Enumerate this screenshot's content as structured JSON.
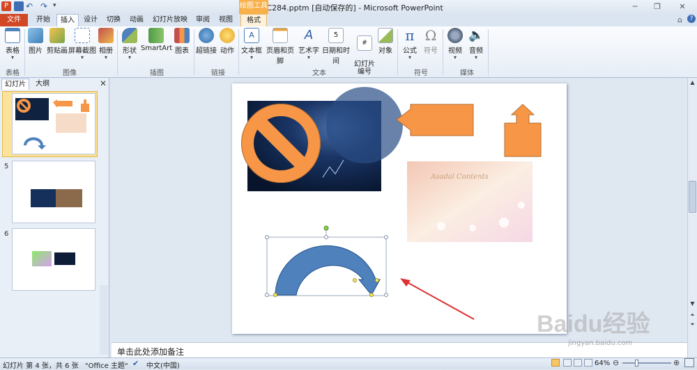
{
  "window": {
    "title": "pptC284.pptm [自动保存的]  -  Microsoft PowerPoint",
    "context_tab": "绘图工具",
    "controls": [
      "─",
      "❐",
      "✕"
    ]
  },
  "tabs": [
    "文件",
    "开始",
    "插入",
    "设计",
    "切换",
    "动画",
    "幻灯片放映",
    "审阅",
    "视图",
    "格式"
  ],
  "ribbon": {
    "tables": {
      "table": "表格",
      "group": "表格"
    },
    "images": {
      "picture": "图片",
      "clipart": "剪贴画",
      "screenshot": "屏幕截图",
      "album": "相册",
      "group": "图像"
    },
    "illustrations": {
      "shapes": "形状",
      "smartart": "SmartArt",
      "chart": "图表",
      "group": "插图"
    },
    "links": {
      "hyperlink": "超链接",
      "action": "动作",
      "group": "链接"
    },
    "text": {
      "textbox": "文本框",
      "header_footer": "页眉和页脚",
      "wordart": "艺术字",
      "datetime": "日期和时间",
      "slide_number": "幻灯片\n编号",
      "object": "对象",
      "group": "文本"
    },
    "symbols": {
      "equation": "公式",
      "symbol": "符号",
      "group": "符号"
    },
    "media": {
      "video": "视频",
      "audio": "音频",
      "group": "媒体"
    }
  },
  "panel": {
    "tab_slides": "幻灯片",
    "tab_outline": "大纲",
    "slides": [
      "4",
      "5",
      "6"
    ]
  },
  "notes_placeholder": "单击此处添加备注",
  "status": {
    "slide": "幻灯片 第 4 张，共 6 张",
    "theme": "\"Office 主题\"",
    "language": "中文(中国)",
    "zoom": "64%"
  },
  "slide": {
    "watermark_text": "Asadal Contents"
  },
  "watermark": {
    "brand": "Baidu经验",
    "url": "jingyan.baidu.com"
  },
  "colors": {
    "accent_orange": "#f79646",
    "shape_blue": "#4f81bd",
    "file_tab": "#d24726"
  }
}
